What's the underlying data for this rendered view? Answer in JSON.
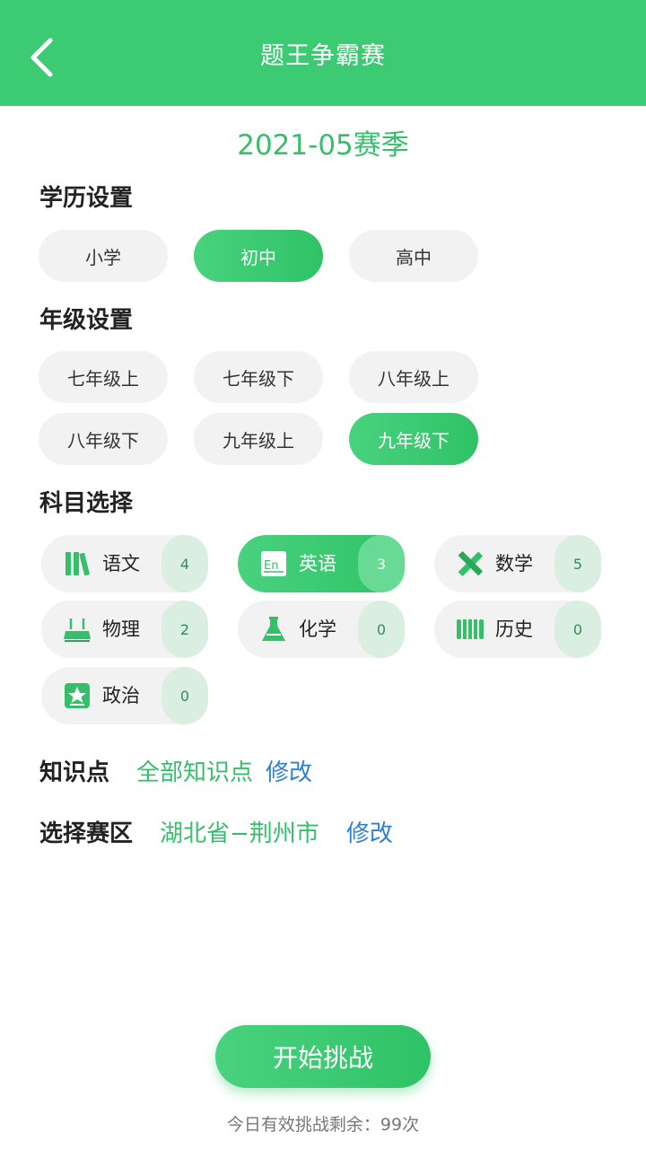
{
  "header": {
    "title": "题王争霸赛"
  },
  "season": "2021-05赛季",
  "education": {
    "title": "学历设置",
    "options": [
      "小学",
      "初中",
      "高中"
    ],
    "selected": "初中"
  },
  "grade": {
    "title": "年级设置",
    "options": [
      "七年级上",
      "七年级下",
      "八年级上",
      "八年级下",
      "九年级上",
      "九年级下"
    ],
    "selected": "九年级下"
  },
  "subjects": {
    "title": "科目选择",
    "items": [
      {
        "label": "语文",
        "count": "4",
        "icon": "books-icon"
      },
      {
        "label": "英语",
        "count": "3",
        "icon": "english-en-icon"
      },
      {
        "label": "数学",
        "count": "5",
        "icon": "ruler-pencil-icon"
      },
      {
        "label": "物理",
        "count": "2",
        "icon": "router-icon"
      },
      {
        "label": "化学",
        "count": "0",
        "icon": "flask-icon"
      },
      {
        "label": "历史",
        "count": "0",
        "icon": "scroll-icon"
      },
      {
        "label": "政治",
        "count": "0",
        "icon": "star-badge-icon"
      }
    ],
    "selected": "英语"
  },
  "knowledge": {
    "label": "知识点",
    "value": "全部知识点",
    "edit": "修改"
  },
  "region": {
    "label": "选择赛区",
    "value": "湖北省−荆州市",
    "edit": "修改"
  },
  "start_button": "开始挑战",
  "remaining": "今日有效挑战剩余：99次",
  "colors": {
    "primary": "#3cca72",
    "link": "#2f7fd0",
    "count_bg": "#dbeee2"
  }
}
